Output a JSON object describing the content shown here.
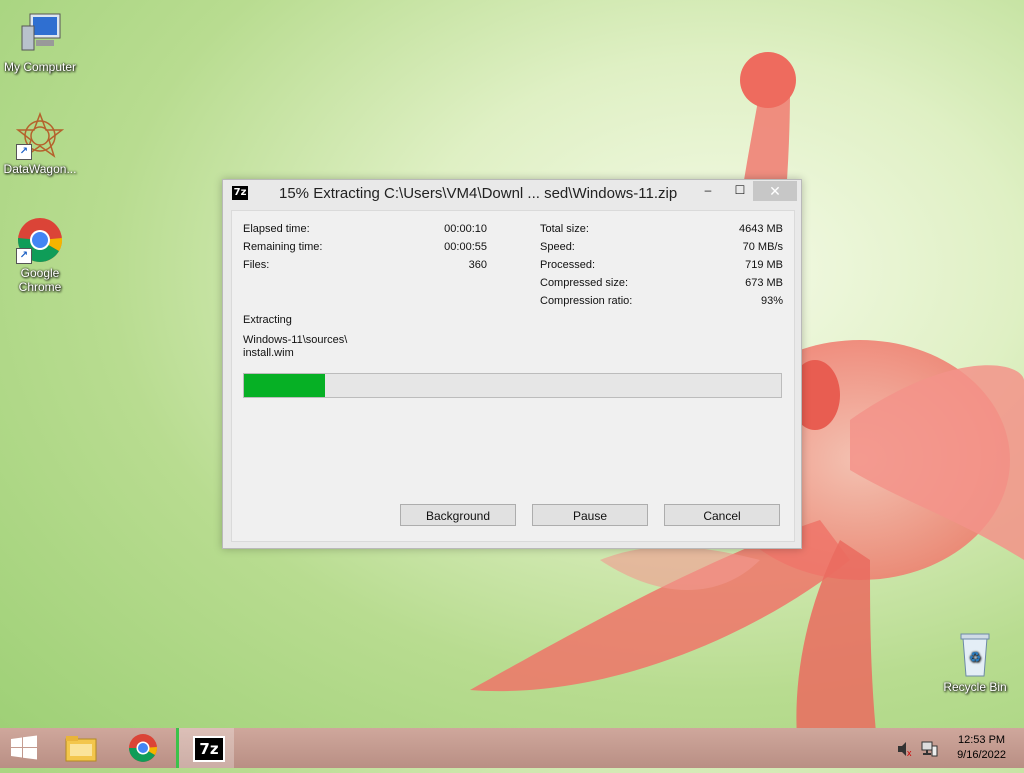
{
  "desktop": {
    "icons": [
      {
        "label": "My Computer"
      },
      {
        "label": "DataWagon..."
      },
      {
        "label_line1": "Google",
        "label_line2": "Chrome"
      },
      {
        "label": "Recycle Bin"
      }
    ]
  },
  "dialog": {
    "app_icon": "7z",
    "title": "15% Extracting C:\\Users\\VM4\\Downl ... sed\\Windows-11.zip",
    "controls": {
      "minimize": "–",
      "maximize": "☐",
      "close": "✕"
    },
    "stats_left": [
      {
        "label": "Elapsed time:",
        "value": "00:00:10"
      },
      {
        "label": "Remaining time:",
        "value": "00:00:55"
      },
      {
        "label": "Files:",
        "value": "360"
      }
    ],
    "stats_right": [
      {
        "label": "Total size:",
        "value": "4643 MB"
      },
      {
        "label": "Speed:",
        "value": "70 MB/s"
      },
      {
        "label": "Processed:",
        "value": "719 MB"
      },
      {
        "label": "Compressed size:",
        "value": "673 MB"
      },
      {
        "label": "Compression ratio:",
        "value": "93%"
      }
    ],
    "status": "Extracting",
    "current_file_line1": "Windows-11\\sources\\",
    "current_file_line2": "install.wim",
    "progress_fraction": 0.15,
    "buttons": {
      "background": "Background",
      "pause": "Pause",
      "cancel": "Cancel"
    }
  },
  "taskbar": {
    "apps": [
      "start",
      "file-explorer",
      "chrome",
      "7-zip"
    ],
    "sevenzip_label": "7z",
    "clock": {
      "time": "12:53 PM",
      "date": "9/16/2022"
    }
  },
  "colors": {
    "progress": "#06b025",
    "taskbar": "#c29a8f"
  }
}
